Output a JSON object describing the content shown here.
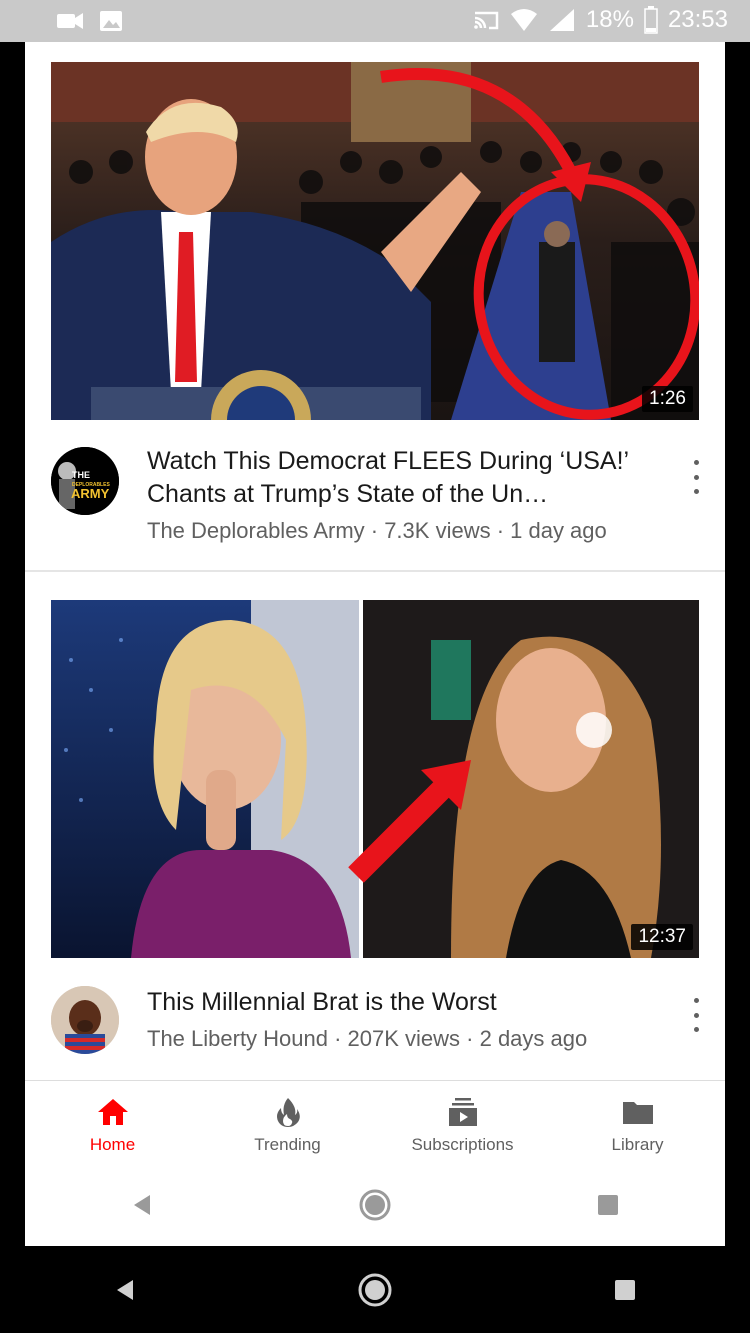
{
  "status_bar": {
    "icons_left": [
      "video-camera-icon",
      "image-icon"
    ],
    "icons_right": [
      "cast-icon",
      "wifi-icon",
      "signal-icon",
      "battery-icon"
    ],
    "battery": "18%",
    "time": "23:53"
  },
  "videos": [
    {
      "title": "Watch This Democrat FLEES During ‘USA!’ Chants at Trump’s State of the Un…",
      "channel": "The Deplorables Army",
      "meta": "The Deplorables Army · 7.3K views · 1 day ago",
      "duration": "1:26",
      "avatar_text": [
        "THE",
        "DEPLORABLES",
        "ARMY"
      ]
    },
    {
      "title": "This Millennial Brat is the Worst",
      "channel": "The Liberty Hound",
      "meta": "The Liberty Hound · 207K views · 2 days ago",
      "duration": "12:37"
    }
  ],
  "bottom_nav": [
    {
      "label": "Home",
      "icon": "home-icon",
      "active": true
    },
    {
      "label": "Trending",
      "icon": "flame-icon",
      "active": false
    },
    {
      "label": "Subscriptions",
      "icon": "subscriptions-icon",
      "active": false
    },
    {
      "label": "Library",
      "icon": "folder-icon",
      "active": false
    }
  ],
  "colors": {
    "accent": "#ff0000",
    "status_bar": "#c9c9c9",
    "text_primary": "#1a1a1a",
    "text_secondary": "#606060"
  }
}
